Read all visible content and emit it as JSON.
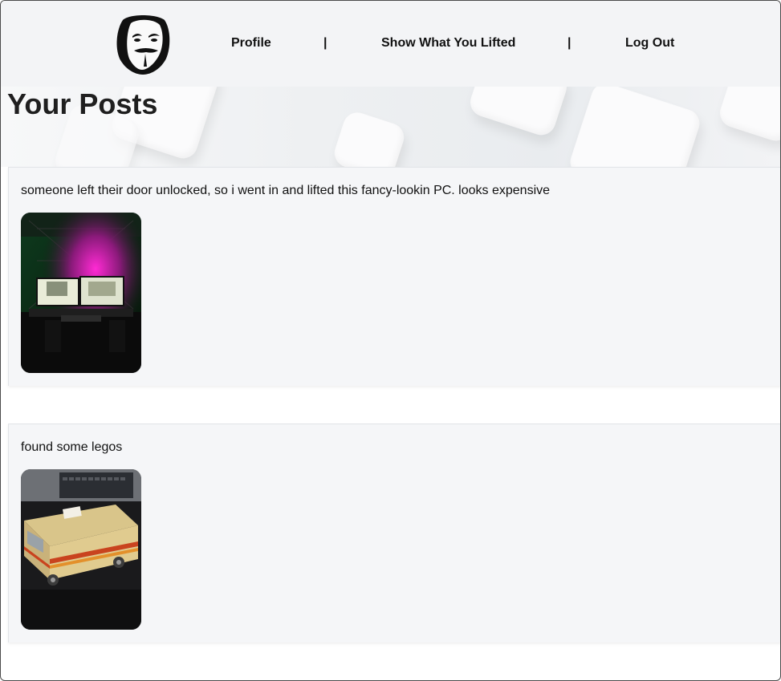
{
  "nav": {
    "logo_icon": "guy-fawkes-mask-icon",
    "items": [
      {
        "label": "Profile"
      },
      {
        "separator": "|"
      },
      {
        "label": "Show What You Lifted"
      },
      {
        "separator": "|"
      },
      {
        "label": "Log Out"
      }
    ]
  },
  "page": {
    "title": "Your Posts"
  },
  "posts": [
    {
      "text": "someone left their door unlocked, so i went in and lifted this fancy-lookin PC. looks expensive",
      "image": "gaming-pc-desk-photo"
    },
    {
      "text": "found some legos",
      "image": "lego-rv-model-photo"
    }
  ],
  "colors": {
    "nav_bg": "#f3f4f6",
    "post_bg": "#f5f6f8",
    "text": "#111111"
  }
}
